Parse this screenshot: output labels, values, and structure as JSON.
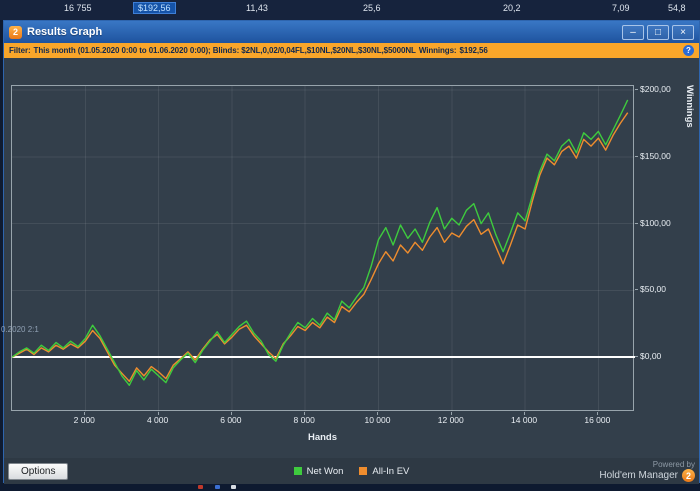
{
  "background": {
    "stats_row": {
      "cells": [
        "16 755",
        "$192,56",
        "11,43",
        "25,6",
        "20,2",
        "7,09",
        "54,8"
      ],
      "highlighted_cell": "$192,56"
    },
    "artifact_text": "0.2020 2:1",
    "fragment_colors": [
      "#c0392b",
      "#3b6fd2",
      "#d8dde3"
    ]
  },
  "window": {
    "title": "Results Graph",
    "icon_glyph": "2",
    "controls": {
      "minimize": "–",
      "maximize": "□",
      "close": "×"
    }
  },
  "filter_bar": {
    "label": "Filter:",
    "value": "This month (01.05.2020 0:00 to 01.06.2020 0:00); Blinds: $2NL,0,02/0,04FL,$10NL,$20NL,$30NL,$5000NL",
    "winnings_label": "Winnings:",
    "winnings_value": "$192,56",
    "help_glyph": "?"
  },
  "chart_data": {
    "type": "line",
    "title": "",
    "xlabel": "Hands",
    "ylabel": "Winnings",
    "xlim": [
      0,
      17000
    ],
    "ylim": [
      -41,
      203
    ],
    "x_step": 200,
    "grid": true,
    "legend_position": "bottom",
    "zero_line_value": 0,
    "x_ticks": {
      "labels": [
        "2 000",
        "4 000",
        "6 000",
        "8 000",
        "10 000",
        "12 000",
        "14 000",
        "16 000"
      ],
      "values": [
        2000,
        4000,
        6000,
        8000,
        10000,
        12000,
        14000,
        16000
      ]
    },
    "y_ticks": {
      "labels": [
        "$0,00",
        "$50,00",
        "$100,00",
        "$150,00",
        "$200,00"
      ],
      "values": [
        0,
        50,
        100,
        150,
        200
      ]
    },
    "series": [
      {
        "name": "Net Won",
        "color": "#3ecb3e",
        "values": [
          0,
          4,
          7,
          3,
          9,
          5,
          11,
          7,
          12,
          8,
          14,
          24,
          16,
          6,
          -4,
          -14,
          -21,
          -10,
          -17,
          -9,
          -14,
          -19,
          -8,
          -2,
          3,
          -4,
          5,
          12,
          19,
          11,
          17,
          23,
          27,
          18,
          12,
          2,
          -3,
          9,
          18,
          26,
          22,
          29,
          24,
          33,
          28,
          42,
          37,
          45,
          52,
          68,
          88,
          97,
          84,
          99,
          89,
          96,
          86,
          101,
          112,
          96,
          104,
          99,
          110,
          115,
          100,
          108,
          92,
          79,
          93,
          108,
          102,
          121,
          139,
          152,
          147,
          158,
          163,
          153,
          168,
          163,
          169,
          159,
          170,
          181,
          192.6
        ]
      },
      {
        "name": "All-In EV",
        "color": "#ef8d2e",
        "values": [
          0,
          3,
          6,
          2,
          7,
          4,
          9,
          6,
          10,
          7,
          12,
          20,
          14,
          4,
          -6,
          -12,
          -18,
          -8,
          -14,
          -7,
          -11,
          -16,
          -6,
          -1,
          4,
          -2,
          6,
          13,
          17,
          10,
          15,
          21,
          24,
          16,
          10,
          4,
          -1,
          10,
          16,
          23,
          20,
          26,
          22,
          30,
          26,
          38,
          34,
          41,
          47,
          58,
          70,
          79,
          72,
          84,
          78,
          86,
          80,
          90,
          97,
          86,
          93,
          90,
          98,
          103,
          92,
          96,
          83,
          70,
          84,
          99,
          96,
          117,
          136,
          149,
          144,
          154,
          158,
          149,
          163,
          158,
          164,
          155,
          166,
          175,
          183
        ]
      }
    ]
  },
  "bottom_bar": {
    "options_label": "Options",
    "powered_by_line1": "Powered by",
    "powered_by_line2": "Hold'em Manager",
    "logo_glyph": "2"
  }
}
